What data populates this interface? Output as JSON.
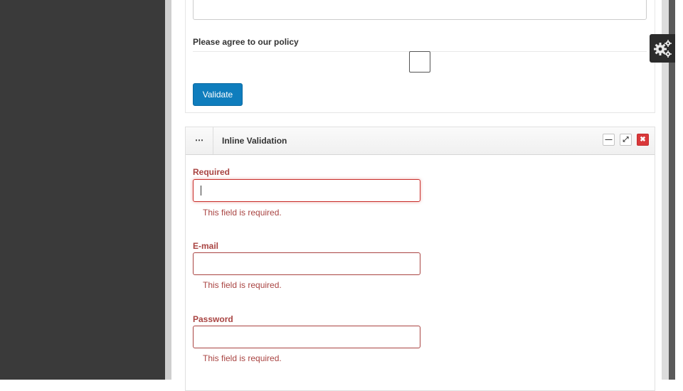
{
  "top_form": {
    "input_value": "",
    "policy_label": "Please agree to our policy",
    "validate_button": "Validate"
  },
  "inline_validation": {
    "dots": "⋯",
    "title": "Inline Validation",
    "controls": {
      "minimize": "—",
      "expand": "⤢",
      "close": "✖"
    },
    "fields": [
      {
        "label": "Required",
        "value": "",
        "error": "This field is required."
      },
      {
        "label": "E-mail",
        "value": "",
        "error": "This field is required."
      },
      {
        "label": "Password",
        "value": "",
        "error": "This field is required."
      }
    ]
  },
  "settings_tab": {
    "icon": "gears-icon"
  },
  "colors": {
    "error": "#a94442",
    "button": "#0f7dbd",
    "close": "#d9383a",
    "sidebar": "#3a3a3a"
  }
}
